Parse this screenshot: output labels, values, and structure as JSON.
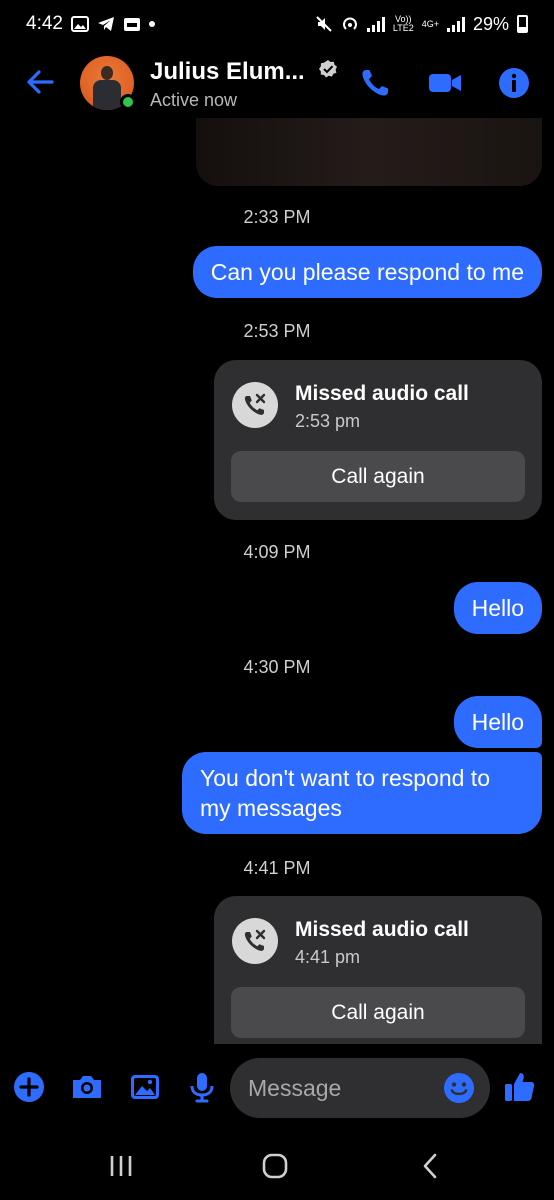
{
  "status_bar": {
    "time": "4:42",
    "network_label_top": "Vo))",
    "network_label_bottom": "LTE2",
    "network_4g_label": "4G+",
    "battery": "29%"
  },
  "header": {
    "contact_name": "Julius Elum...",
    "status": "Active now",
    "accent_color": "#2d6cff"
  },
  "messages": [
    {
      "type": "timestamp",
      "text": "2:33 PM"
    },
    {
      "type": "outgoing",
      "text": "Can you please respond to me"
    },
    {
      "type": "timestamp",
      "text": "2:53 PM"
    },
    {
      "type": "missed_call",
      "title": "Missed audio call",
      "time": "2:53 pm",
      "button": "Call again"
    },
    {
      "type": "timestamp",
      "text": "4:09 PM"
    },
    {
      "type": "outgoing",
      "text": "Hello"
    },
    {
      "type": "timestamp",
      "text": "4:30 PM"
    },
    {
      "type": "outgoing",
      "text": "Hello"
    },
    {
      "type": "outgoing",
      "text": "You don't want to respond to my messages"
    },
    {
      "type": "timestamp",
      "text": "4:41 PM"
    },
    {
      "type": "missed_call",
      "title": "Missed audio call",
      "time": "4:41 pm",
      "button": "Call again"
    }
  ],
  "composer": {
    "placeholder": "Message"
  },
  "icons": {
    "header": [
      "back-arrow-icon",
      "verified-badge-icon",
      "phone-icon",
      "video-camera-icon",
      "info-icon"
    ],
    "composer": [
      "plus-icon",
      "camera-icon",
      "gallery-icon",
      "microphone-icon",
      "emoji-icon",
      "thumbs-up-icon"
    ],
    "nav": [
      "recent-apps-icon",
      "home-icon",
      "back-icon"
    ]
  }
}
